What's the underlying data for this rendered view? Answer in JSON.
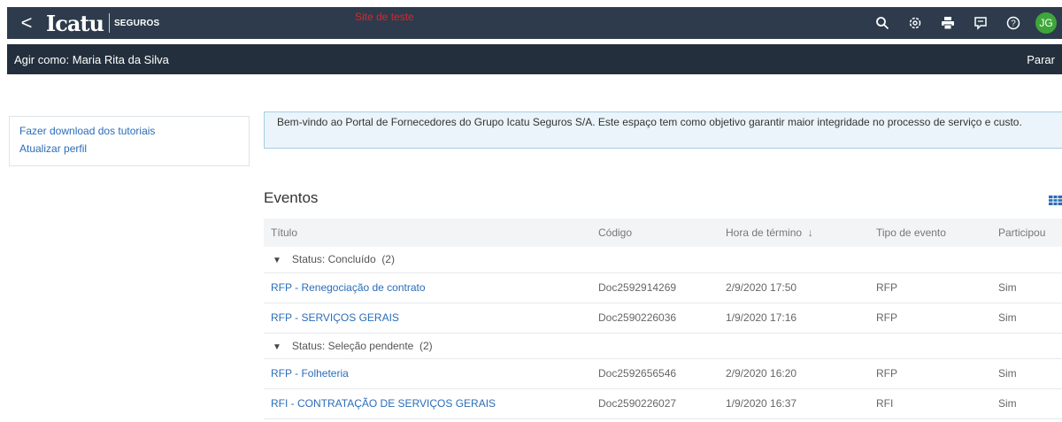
{
  "header": {
    "back_symbol": "<",
    "logo_main": "Icatu",
    "logo_sub": "SEGUROS",
    "site_label": "Site de teste",
    "avatar_initials": "JG",
    "icons": [
      "search-icon",
      "settings-icon",
      "print-icon",
      "feedback-icon",
      "help-icon"
    ]
  },
  "actbar": {
    "label": "Agir como: Maria Rita da Silva",
    "stop": "Parar"
  },
  "sidebar": {
    "links": [
      "Fazer download dos tutoriais",
      "Atualizar perfil"
    ]
  },
  "welcome": {
    "text": "Bem-vindo ao Portal de Fornecedores do Grupo Icatu Seguros S/A. Este espaço tem como objetivo garantir maior integridade no processo de serviço e custo."
  },
  "events": {
    "title": "Eventos",
    "columns": [
      "Título",
      "Código",
      "Hora de término",
      "Tipo de evento",
      "Participou"
    ],
    "sort_arrow": "↓",
    "groups": [
      {
        "label": "Status: Concluído",
        "count": "(2)",
        "rows": [
          {
            "title": "RFP - Renegociação de contrato",
            "code": "Doc2592914269",
            "end": "2/9/2020 17:50",
            "type": "RFP",
            "participated": "Sim"
          },
          {
            "title": "RFP - SERVIÇOS GERAIS",
            "code": "Doc2590226036",
            "end": "1/9/2020 17:16",
            "type": "RFP",
            "participated": "Sim"
          }
        ]
      },
      {
        "label": "Status: Seleção pendente",
        "count": "(2)",
        "rows": [
          {
            "title": "RFP - Folheteria",
            "code": "Doc2592656546",
            "end": "2/9/2020 16:20",
            "type": "RFP",
            "participated": "Sim"
          },
          {
            "title": "RFI - CONTRATAÇÃO DE SERVIÇOS GERAIS",
            "code": "Doc2590226027",
            "end": "1/9/2020 16:37",
            "type": "RFI",
            "participated": "Sim"
          }
        ]
      }
    ]
  },
  "colors": {
    "topbar": "#2d3b4c",
    "actbar": "#232f3c",
    "link": "#2a6db8",
    "site_label": "#e0242a",
    "avatar": "#3ea63a"
  }
}
